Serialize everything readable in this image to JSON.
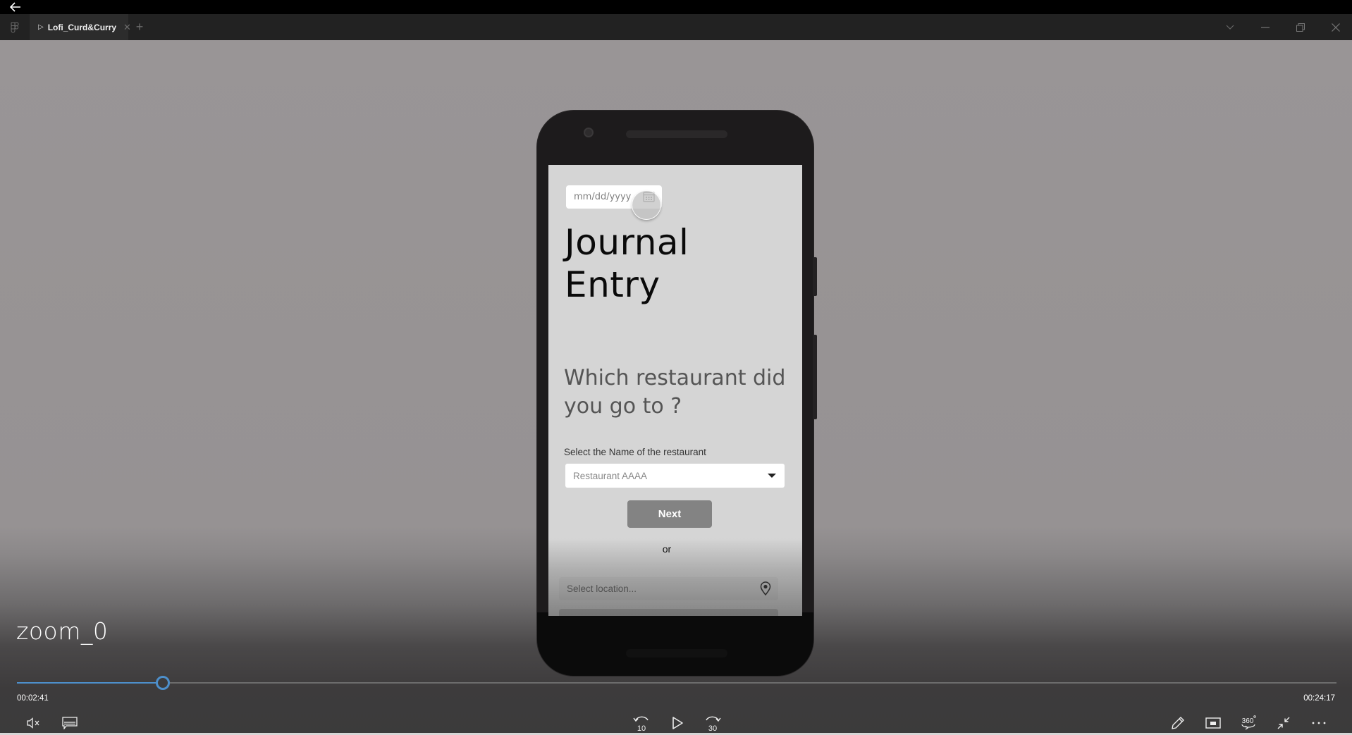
{
  "window": {
    "back_label": "←",
    "tab": {
      "title": "Lofi_Curd&Curry",
      "play_glyph": "▷",
      "close_glyph": "✕"
    },
    "new_tab_glyph": "+",
    "controls": {
      "dropdown_glyph": "⌵",
      "minimize_glyph": "—",
      "close_glyph": "✕"
    }
  },
  "prototype": {
    "date_field": {
      "placeholder": "mm/dd/yyyy"
    },
    "title_line1": "Journal",
    "title_line2": "Entry",
    "question": "Which restaurant did you go to ?",
    "select_label": "Select the Name of the restaurant",
    "select_value": "Restaurant AAAA",
    "next_button": "Next",
    "or_label": "or",
    "location_placeholder": "Select location..."
  },
  "player": {
    "video_title": "zoom_0",
    "current_time": "00:02:41",
    "total_time": "00:24:17",
    "progress_fraction": 0.1105,
    "accent_color": "#4d8fcb",
    "buttons": {
      "mute": "mute-icon",
      "captions": "captions-icon",
      "rewind": "10",
      "play": "play-icon",
      "forward": "30",
      "pen": "pen-icon",
      "miniplayer": "miniplayer-icon",
      "view360": "360",
      "exit_fullscreen": "exit-fullscreen-icon",
      "more": "more-icon"
    }
  }
}
